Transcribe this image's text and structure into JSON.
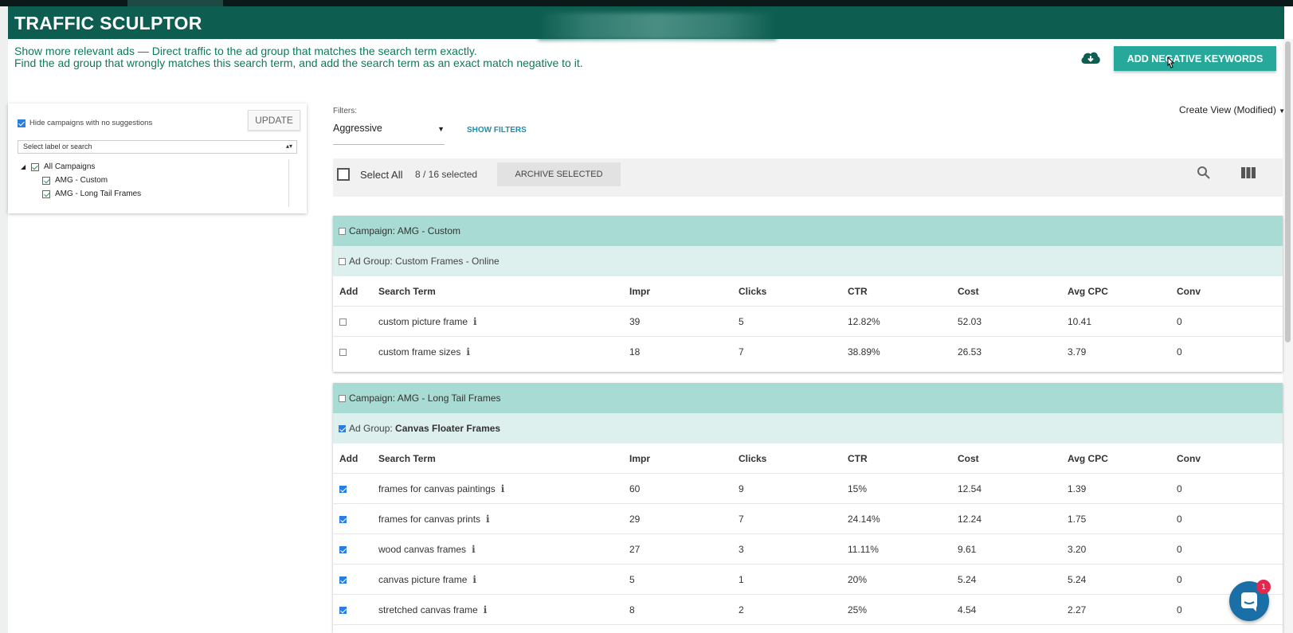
{
  "app": {
    "title": "TRAFFIC SCULPTOR",
    "description_line1": "Show more relevant ads — Direct traffic to the ad group that matches the search term exactly.",
    "description_line2": "Find the ad group that wrongly matches this search term, and add the search term as an exact match negative to it.",
    "add_negative_label": "ADD NEGATIVE KEYWORDS",
    "accent_color": "#0d5e51",
    "button_color": "#26a99a"
  },
  "sidebar": {
    "hide_label": "Hide campaigns with no suggestions",
    "hide_checked": true,
    "update_label": "UPDATE",
    "label_select_placeholder": "Select label or search",
    "tree": [
      {
        "label": "All Campaigns",
        "checked": true
      },
      {
        "label": "AMG - Custom",
        "checked": true
      },
      {
        "label": "AMG - Long Tail Frames",
        "checked": true
      }
    ]
  },
  "filters": {
    "label": "Filters:",
    "selected": "Aggressive",
    "show_filters_label": "SHOW FILTERS",
    "create_view_label": "Create View (Modified)"
  },
  "toolbar": {
    "select_all_label": "Select All",
    "selected_count": "8 / 16 selected",
    "archive_label": "ARCHIVE SELECTED"
  },
  "columns": [
    "Add",
    "Search Term",
    "Impr",
    "Clicks",
    "CTR",
    "Cost",
    "Avg CPC",
    "Conv"
  ],
  "groups": [
    {
      "campaign": "Campaign: AMG - Custom",
      "ad_group_prefix": "Ad Group: ",
      "ad_group": "Custom Frames - Online",
      "ad_group_checked": false,
      "rows": [
        {
          "term": "custom picture frame",
          "impr": "39",
          "clicks": "5",
          "ctr": "12.82%",
          "cost": "52.03",
          "cpc": "10.41",
          "conv": "0",
          "checked": false
        },
        {
          "term": "custom frame sizes",
          "impr": "18",
          "clicks": "7",
          "ctr": "38.89%",
          "cost": "26.53",
          "cpc": "3.79",
          "conv": "0",
          "checked": false
        }
      ]
    },
    {
      "campaign": "Campaign: AMG - Long Tail Frames",
      "ad_group_prefix": "Ad Group: ",
      "ad_group": "Canvas Floater Frames",
      "ad_group_checked": true,
      "rows": [
        {
          "term": "frames for canvas paintings",
          "impr": "60",
          "clicks": "9",
          "ctr": "15%",
          "cost": "12.54",
          "cpc": "1.39",
          "conv": "0",
          "checked": true
        },
        {
          "term": "frames for canvas prints",
          "impr": "29",
          "clicks": "7",
          "ctr": "24.14%",
          "cost": "12.24",
          "cpc": "1.75",
          "conv": "0",
          "checked": true
        },
        {
          "term": "wood canvas frames",
          "impr": "27",
          "clicks": "3",
          "ctr": "11.11%",
          "cost": "9.61",
          "cpc": "3.20",
          "conv": "0",
          "checked": true
        },
        {
          "term": "canvas picture frame",
          "impr": "5",
          "clicks": "1",
          "ctr": "20%",
          "cost": "5.24",
          "cpc": "5.24",
          "conv": "0",
          "checked": true
        },
        {
          "term": "stretched canvas frame",
          "impr": "8",
          "clicks": "2",
          "ctr": "25%",
          "cost": "4.54",
          "cpc": "2.27",
          "conv": "0",
          "checked": true
        }
      ]
    }
  ],
  "chat": {
    "badge": "1"
  }
}
